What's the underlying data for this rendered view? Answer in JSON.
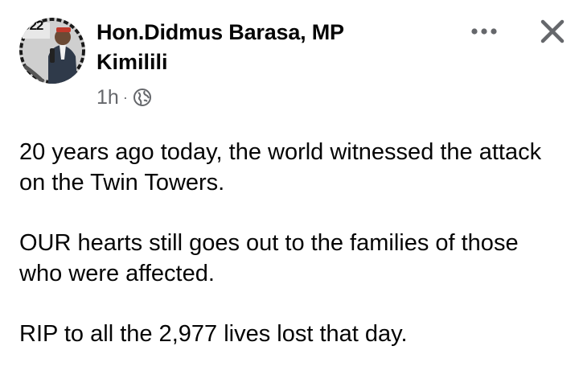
{
  "post": {
    "author": {
      "name": "Hon.Didmus Barasa, MP",
      "subtitle": "Kimilili",
      "avatar_badge": "022"
    },
    "meta": {
      "time": "1h",
      "separator": "·",
      "privacy_icon": "globe-icon"
    },
    "actions": {
      "more_icon": "more-horizontal-icon",
      "close_icon": "close-icon"
    },
    "paragraphs": [
      "20 years ago today, the world witnessed the attack on the Twin Towers.",
      "OUR hearts still goes out to the families of those who were affected.",
      "RIP to all the 2,977 lives lost that day."
    ]
  },
  "colors": {
    "text_primary": "#050505",
    "text_secondary": "#65676b",
    "background": "#ffffff"
  }
}
